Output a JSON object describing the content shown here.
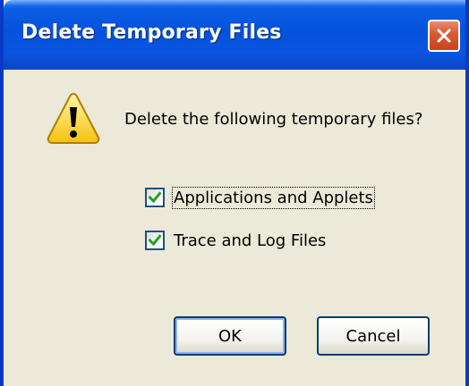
{
  "dialog": {
    "title": "Delete Temporary Files",
    "prompt": "Delete the following temporary files?",
    "icon": "warning-icon",
    "close_icon": "close-icon"
  },
  "options": [
    {
      "label": "Applications and Applets",
      "checked": true
    },
    {
      "label": "Trace and Log Files",
      "checked": true
    }
  ],
  "buttons": {
    "ok": "OK",
    "cancel": "Cancel"
  },
  "colors": {
    "titlebar": "#0551dc",
    "close_button": "#dc5b34",
    "dialog_background": "#ece9d8",
    "checkmark": "#21a121"
  }
}
